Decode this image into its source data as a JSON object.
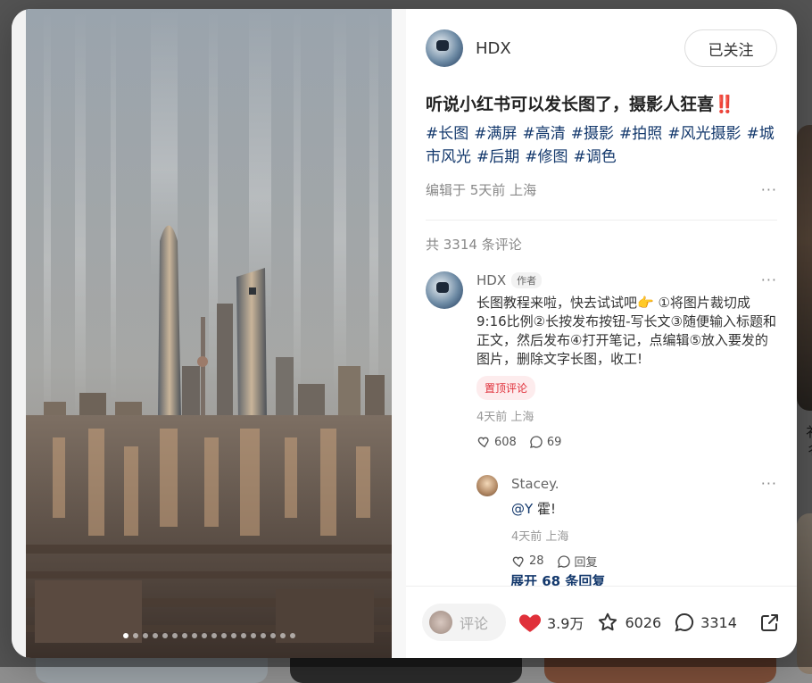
{
  "background": {
    "partial_text": "衤 彳"
  },
  "media": {
    "dots_total": 18,
    "dot_active_index": 0
  },
  "author": {
    "name": "HDX",
    "follow_label": "已关注"
  },
  "note": {
    "title": "听说小红书可以发长图了，摄影人狂喜",
    "title_emoji": "‼️",
    "tags": [
      "#长图",
      "#满屏",
      "#高清",
      "#摄影",
      "#拍照",
      "#风光摄影",
      "#城市风光",
      "#后期",
      "#修图",
      "#调色"
    ],
    "edited_meta": "编辑于 5天前 上海",
    "more_icon": "···"
  },
  "comments": {
    "count_label": "共 3314 条评论",
    "top": {
      "author": "HDX",
      "author_badge": "作者",
      "text": "长图教程来啦，快去试试吧👉 ①将图片裁切成9:16比例②长按发布按钮-写长文③随便输入标题和正文，然后发布④打开笔记，点编辑⑤放入要发的图片，删除文字长图，收工!",
      "pin_label": "置顶评论",
      "time": "4天前 上海",
      "likes": "608",
      "replies": "69",
      "more_icon": "···"
    },
    "reply": {
      "author": "Stacey.",
      "mention": "@Y",
      "text": " 霍!",
      "time": "4天前 上海",
      "likes": "28",
      "reply_label": "回复",
      "more_icon": "···"
    },
    "expand_label": "展开 68 条回复"
  },
  "bottom_bar": {
    "comment_placeholder": "评论",
    "likes": "3.9万",
    "collects": "6026",
    "comments": "3314"
  },
  "colors": {
    "accent_red": "#e0303a",
    "link_blue": "#13386c"
  }
}
